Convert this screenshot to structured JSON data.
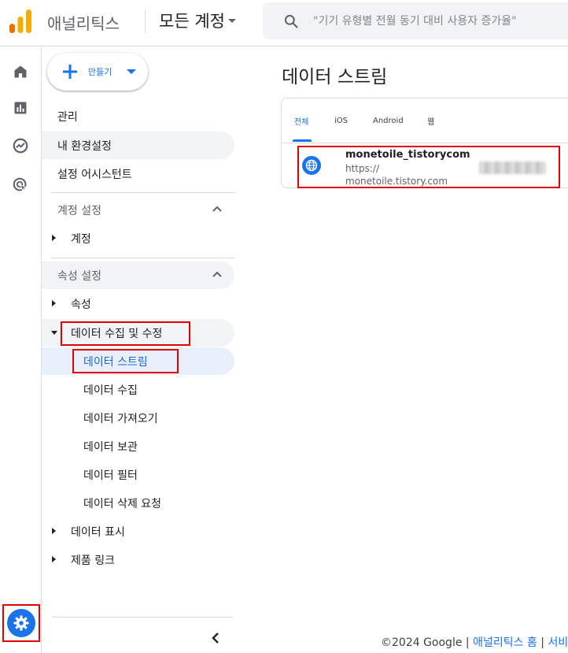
{
  "app": {
    "name": "애널리틱스",
    "account": "모든 계정"
  },
  "search": {
    "placeholder": "\"기기 유형별 전월 동기 대비 사용자 증가율\""
  },
  "rail": {
    "items": [
      "home-icon",
      "reports-icon",
      "explore-icon",
      "advertising-icon"
    ],
    "settings_icon": "gear-icon"
  },
  "nav": {
    "create_label": "만들기",
    "admin": "관리",
    "preferences": "내 환경설정",
    "setup_assistant": "설정 어시스턴트",
    "account_settings": {
      "header": "계정 설정",
      "items": [
        "계정"
      ]
    },
    "property_settings": {
      "header": "속성 설정",
      "property": "속성",
      "data_collection": {
        "label": "데이터 수집 및 수정",
        "children": [
          "데이터 스트림",
          "데이터 수집",
          "데이터 가져오기",
          "데이터 보관",
          "데이터 필터",
          "데이터 삭제 요청"
        ]
      },
      "data_display": "데이터 표시",
      "product_links": "제품 링크"
    }
  },
  "main": {
    "title": "데이터 스트림",
    "tabs": [
      "전체",
      "iOS",
      "Android",
      "웹"
    ],
    "active_tab": "전체",
    "streams": [
      {
        "name": "monetoile_tistorycom",
        "url_line1": "https://",
        "url_line2": "monetoile.tistory.com",
        "icon": "globe-icon"
      }
    ]
  },
  "footer": {
    "copyright": "©2024 Google",
    "sep1": "|",
    "link_home": "애널리틱스 홈",
    "sep2": "|",
    "link_terms": "서비"
  },
  "colors": {
    "accent": "#1a73e8",
    "highlight": "#e00000",
    "selected_bg": "#e8f0fe"
  }
}
